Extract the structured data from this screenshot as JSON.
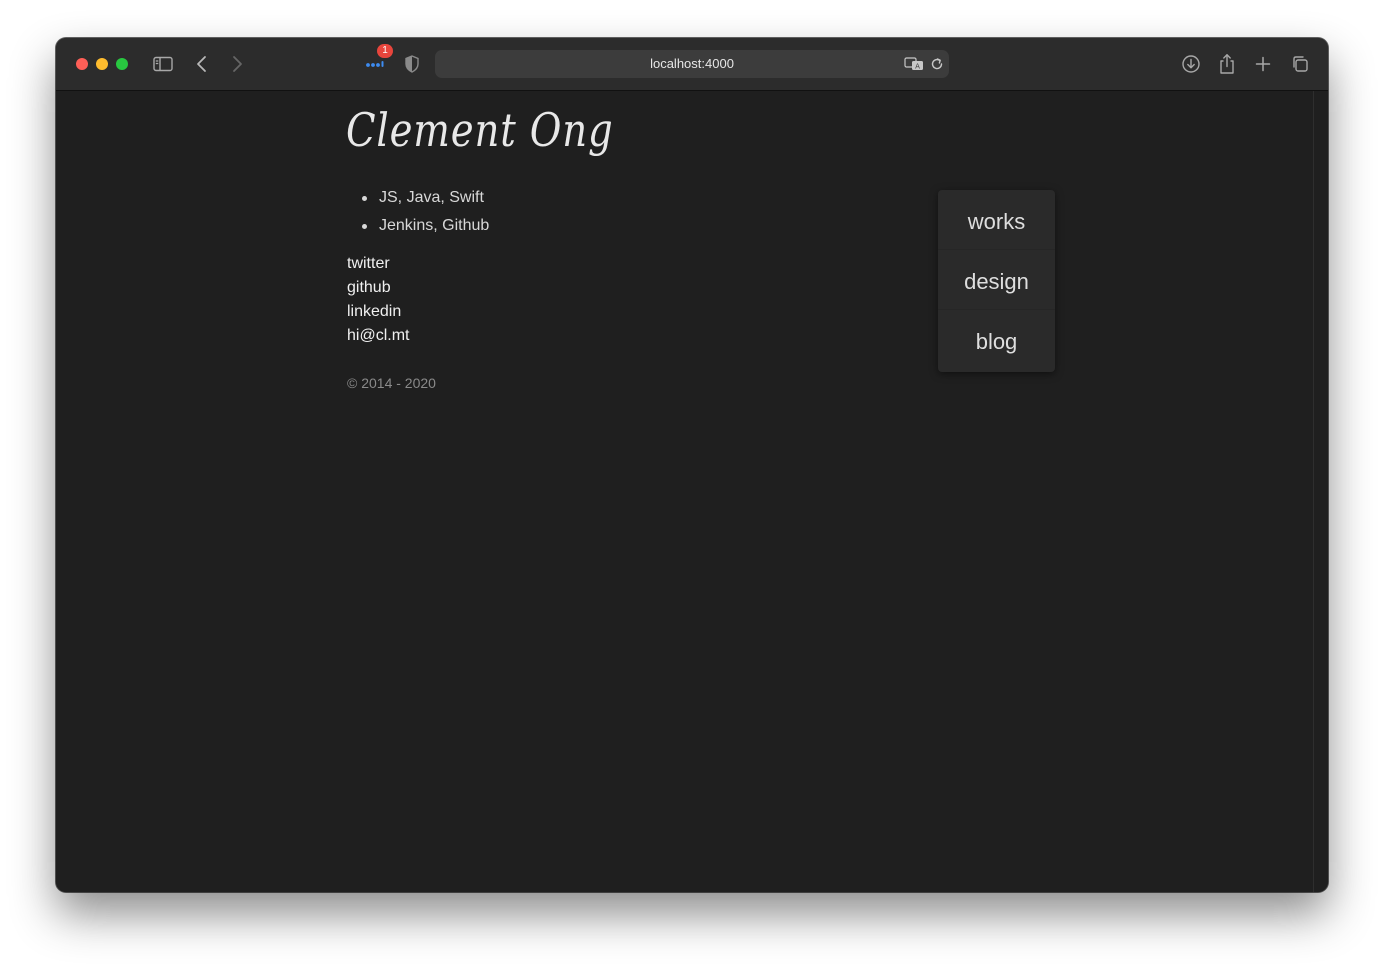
{
  "browser": {
    "url": "localhost:4000",
    "badge_count": "1"
  },
  "page": {
    "title": "Clement Ong",
    "skills": [
      "JS, Java, Swift",
      "Jenkins, Github"
    ],
    "links": [
      "twitter",
      "github",
      "linkedin",
      "hi@cl.mt"
    ],
    "copyright": "© 2014 - 2020"
  },
  "nav": {
    "items": [
      "works",
      "design",
      "blog"
    ]
  },
  "colors": {
    "background": "#1f1f1f",
    "toolbar": "#2c2c2c",
    "card": "#2a2a2a",
    "badge": "#e8453c"
  },
  "icons": [
    "sidebar-icon",
    "back-chevron-icon",
    "forward-chevron-icon",
    "extensions-icon",
    "privacy-shield-icon",
    "translate-icon",
    "reload-icon",
    "download-icon",
    "share-icon",
    "new-tab-plus-icon",
    "tab-overview-icon"
  ]
}
